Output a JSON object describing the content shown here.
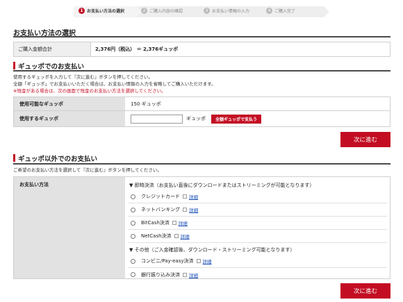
{
  "steps": [
    {
      "num": "1",
      "label": "お支払い方法の選択",
      "active": true
    },
    {
      "num": "2",
      "label": "ご購入内容の確認",
      "active": false
    },
    {
      "num": "3",
      "label": "お支払い情報の入力",
      "active": false
    },
    {
      "num": "4",
      "label": "ご購入完了",
      "active": false
    }
  ],
  "page_title": "お支払い方法の選択",
  "total": {
    "label": "ご購入金額合計",
    "value": "2,376円（税込） ＝ 2,376ギュッポ"
  },
  "gyuppo": {
    "heading": "ギュッポでのお支払い",
    "desc_line1": "使用するギュッポを入力して『次に進む』ボタンを押してください。",
    "desc_line2": "全額「ギュッポ」でお支払いいただく場合は、お支払い情報の入力を省略してご購入いただけます。",
    "desc_warn": "※残金がある場合は、次の画面で残金のお支払い方法を選択してください。",
    "available_label": "使用可能なギュッポ",
    "available_value": "150 ギュッポ",
    "use_label": "使用するギュッポ",
    "use_value": "",
    "unit": "ギュッポ",
    "pay_all_button": "全額ギュッポで支払う"
  },
  "next_button": "次に進む",
  "other": {
    "heading": "ギュッポ以外でのお支払い",
    "desc": "ご希望のお支払い方法を選択して『次に進む』ボタンを押してください。",
    "method_label": "お支払い方法",
    "group1_title": "▼ 即時決済（お支払い直後にダウンロードまたはストリーミングが可能となります）",
    "group1": [
      {
        "label": "クレジットカード",
        "link": "詳細"
      },
      {
        "label": "ネットバンキング",
        "link": "詳細"
      },
      {
        "label": "BitCash決済",
        "link": "詳細"
      },
      {
        "label": "NetCash決済",
        "link": "詳細"
      }
    ],
    "group2_title": "▼ その他（ご入金確認後、ダウンロード・ストリーミング可能となります）",
    "group2": [
      {
        "label": "コンビニ/Pay-easy決済",
        "link": "詳細"
      },
      {
        "label": "銀行振り込み決済",
        "link": "詳細"
      }
    ]
  }
}
